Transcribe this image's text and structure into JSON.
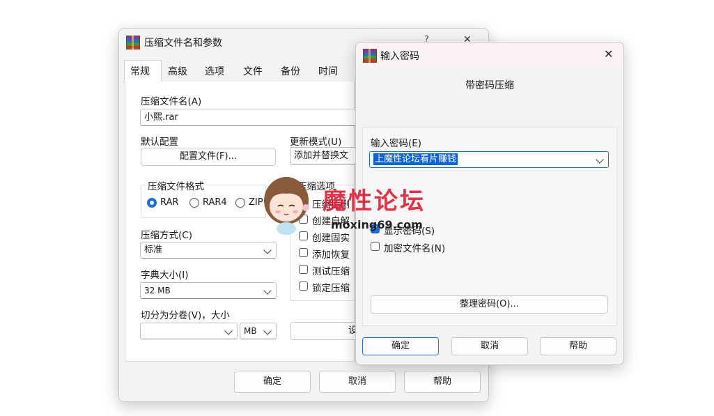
{
  "main_dialog": {
    "title": "压缩文件名和参数",
    "help_glyph": "?",
    "close_glyph": "✕",
    "tabs": [
      "常规",
      "高级",
      "选项",
      "文件",
      "备份",
      "时间"
    ],
    "archive_name_label": "压缩文件名(A)",
    "archive_name_value": "小熙.rar",
    "default_profile_label": "默认配置",
    "profiles_button": "配置文件(F)...",
    "update_mode_label": "更新模式(U)",
    "update_mode_value": "添加并替换文",
    "format_group_label": "压缩文件格式",
    "formats": [
      "RAR",
      "RAR4",
      "ZIP"
    ],
    "selected_format": "RAR",
    "method_label": "压缩方式(C)",
    "method_value": "标准",
    "dict_label": "字典大小(I)",
    "dict_value": "32 MB",
    "split_label": "切分为分卷(V)，大小",
    "split_value": "",
    "split_unit": "MB",
    "options_group_label": "压缩选项",
    "options": [
      "压缩后删",
      "创建自解",
      "创建固实",
      "添加恢复",
      "测试压缩",
      "锁定压缩"
    ],
    "set_button_partial": "设",
    "ok": "确定",
    "cancel": "取消",
    "help": "帮助"
  },
  "password_dialog": {
    "title": "输入密码",
    "close_glyph": "✕",
    "subtitle": "带密码压缩",
    "password_label": "输入密码(E)",
    "password_value": "上魔性论坛看片赚钱",
    "show_password": "显示密码(S)",
    "show_password_checked": true,
    "encrypt_names": "加密文件名(N)",
    "encrypt_names_checked": false,
    "organize_button": "整理密码(O)...",
    "ok": "确定",
    "cancel": "取消",
    "help": "帮助"
  },
  "watermark": {
    "title": "魔性论坛",
    "url": "moxing69.com"
  },
  "colors": {
    "accent": "#1a6ed8",
    "watermark_red": "#e0223a",
    "selection_bg": "#0a64d6"
  }
}
